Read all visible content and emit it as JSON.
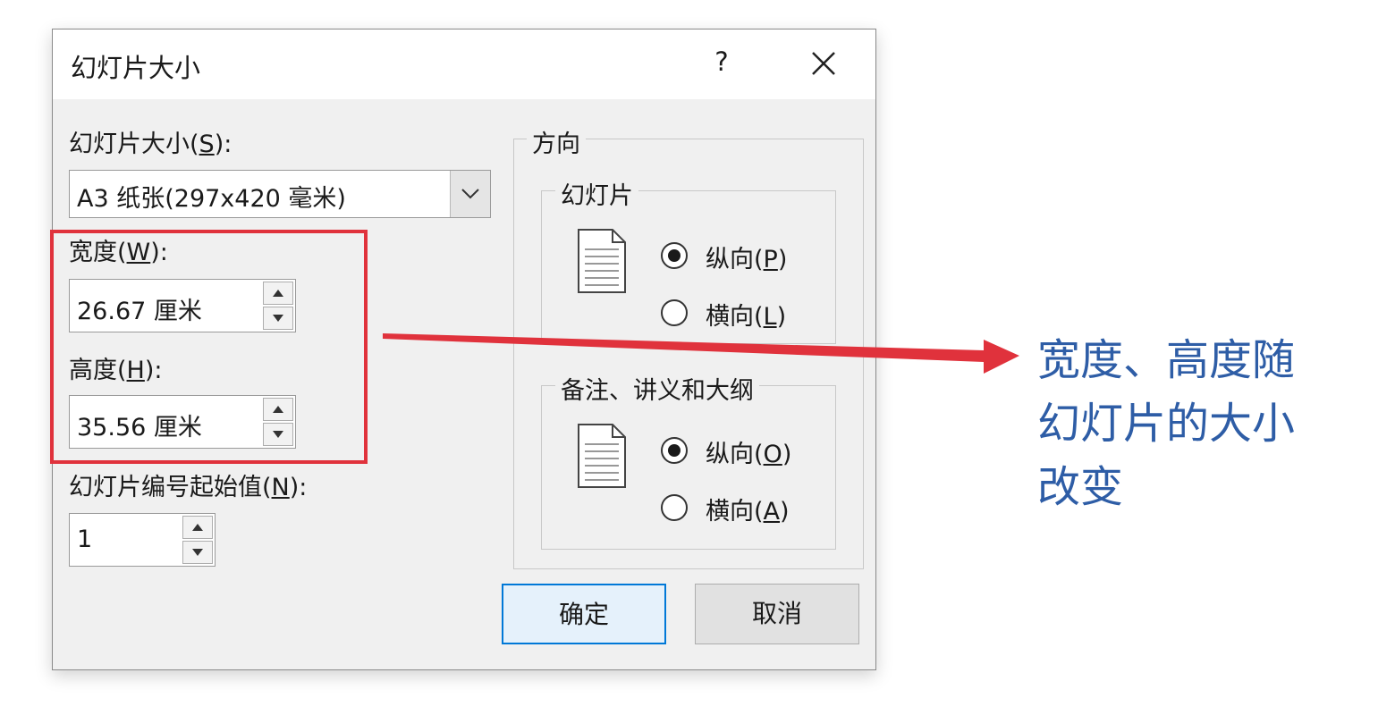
{
  "dialog": {
    "title": "幻灯片大小",
    "help_label": "?",
    "slide_size": {
      "label_text": "幻灯片大小(",
      "label_mnemonic": "S",
      "label_suffix": "):",
      "selected_value": "A3 纸张(297x420 毫米)"
    },
    "width": {
      "label_text": "宽度(",
      "label_mnemonic": "W",
      "label_suffix": "):",
      "value": "26.67 厘米"
    },
    "height": {
      "label_text": "高度(",
      "label_mnemonic": "H",
      "label_suffix": "):",
      "value": "35.56 厘米"
    },
    "numbering": {
      "label_text": "幻灯片编号起始值(",
      "label_mnemonic": "N",
      "label_suffix": "):",
      "value": "1"
    },
    "orientation": {
      "title": "方向",
      "slides": {
        "title": "幻灯片",
        "portrait_text": "纵向(",
        "portrait_mnemonic": "P",
        "landscape_text": "横向(",
        "landscape_mnemonic": "L",
        "selected": "portrait"
      },
      "notes": {
        "title": "备注、讲义和大纲",
        "portrait_text": "纵向(",
        "portrait_mnemonic": "O",
        "landscape_text": "横向(",
        "landscape_mnemonic": "A",
        "selected": "portrait"
      },
      "close_paren": ")"
    },
    "ok_label": "确定",
    "cancel_label": "取消"
  },
  "annotation": {
    "line1": "宽度、高度随",
    "line2": "幻灯片的大小",
    "line3": "改变",
    "color": "#2e5da6",
    "highlight_color": "#e0323c"
  }
}
